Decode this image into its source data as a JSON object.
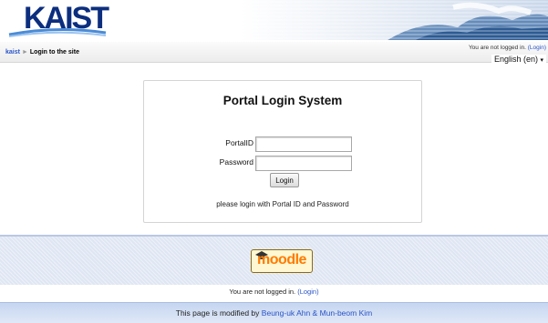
{
  "header": {
    "logo": "KAIST"
  },
  "nav": {
    "breadcrumb": {
      "home": "kaist",
      "current": "Login to the site"
    },
    "login_info": {
      "text": "You are not logged in.",
      "link": "(Login)"
    },
    "language": "English (en)"
  },
  "login_box": {
    "title": "Portal Login System",
    "id_label": "PortalID",
    "id_value": "",
    "password_label": "Password",
    "password_value": "",
    "login_button": "Login",
    "hint": "please login with Portal ID and Password"
  },
  "footer": {
    "logo_text": "moodle",
    "status_text": "You are not logged in.",
    "status_link": "(Login)",
    "modified_prefix": "This page is modified by",
    "modified_authors": "Beung-uk Ahn & Mun-beom Kim"
  },
  "colors": {
    "logo_blue": "#0c2e7e",
    "link_blue": "#2a55c8",
    "moodle_orange": "#ff7a00",
    "footer_band": "#dfe6f3"
  }
}
